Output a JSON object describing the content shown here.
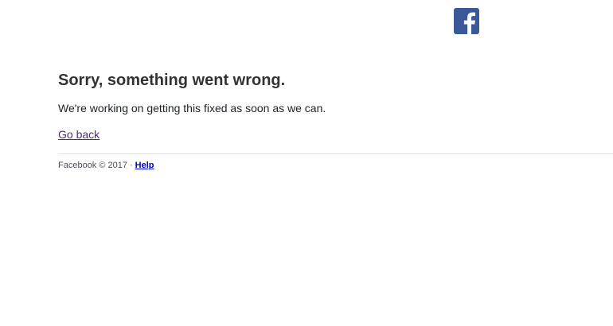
{
  "header": {
    "logo_icon": "facebook-logo-icon",
    "brand_color": "#3b5998"
  },
  "error": {
    "title": "Sorry, something went wrong.",
    "message": "We're working on getting this fixed as soon as we can.",
    "go_back_label": "Go back"
  },
  "footer": {
    "copyright": "Facebook © 2017",
    "separator": "·",
    "help_label": "Help"
  }
}
